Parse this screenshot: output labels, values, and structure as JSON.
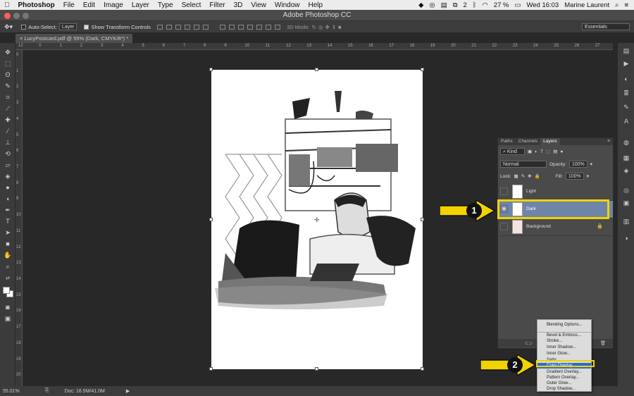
{
  "menubar": {
    "apple": "",
    "items": [
      "Photoshop",
      "File",
      "Edit",
      "Image",
      "Layer",
      "Type",
      "Select",
      "Filter",
      "3D",
      "View",
      "Window",
      "Help"
    ],
    "battery": "27 %",
    "clock": "Wed 16:03",
    "user": "Marine Laurent",
    "badge_num": "2"
  },
  "window": {
    "title": "Adobe Photoshop CC"
  },
  "options": {
    "auto_select_label": "Auto-Select:",
    "auto_select_value": "Layer",
    "show_transform_label": "Show Transform Controls",
    "mode_label": "3D Mode:",
    "workspace": "Essentials"
  },
  "document": {
    "tab": "LucyPostcard.pdf @ 55% (Dark, CMYK/8*) *",
    "ruler_numbers": [
      "12",
      "0",
      "1",
      "2",
      "3",
      "4",
      "5",
      "6",
      "7",
      "8",
      "9",
      "10",
      "11",
      "12",
      "13",
      "14",
      "15",
      "16",
      "17",
      "18",
      "19",
      "20",
      "21",
      "22",
      "23",
      "24",
      "25",
      "26",
      "27"
    ],
    "vruler_numbers": [
      "0",
      "1",
      "2",
      "3",
      "4",
      "5",
      "6",
      "7",
      "8",
      "9",
      "10",
      "11",
      "12",
      "13",
      "14",
      "15",
      "16",
      "17",
      "18",
      "19",
      "20"
    ]
  },
  "status": {
    "zoom": "55.01%",
    "doc": "Doc: 16.5M/41.0M"
  },
  "layers_panel": {
    "tabs": [
      "Paths",
      "Channels",
      "Layers"
    ],
    "active_tab": "Layers",
    "kind_label": "Kind",
    "blend_mode": "Normal",
    "opacity_label": "Opacity:",
    "opacity_value": "100%",
    "lock_label": "Lock:",
    "fill_label": "Fill:",
    "fill_value": "100%",
    "layers": [
      {
        "name": "Light",
        "visible": false
      },
      {
        "name": "Dark",
        "visible": true,
        "selected": true
      },
      {
        "name": "Background",
        "visible": false,
        "locked": true
      }
    ]
  },
  "context_menu": {
    "items": [
      {
        "label": "Blending Options..."
      },
      {
        "label": "Bevel & Emboss..."
      },
      {
        "label": "Stroke..."
      },
      {
        "label": "Inner Shadow..."
      },
      {
        "label": "Inner Glow..."
      },
      {
        "label": "Satin..."
      },
      {
        "label": "Color Overlay...",
        "highlighted": true
      },
      {
        "label": "Gradient Overlay..."
      },
      {
        "label": "Pattern Overlay..."
      },
      {
        "label": "Outer Glow..."
      },
      {
        "label": "Drop Shadow..."
      }
    ]
  },
  "callouts": [
    {
      "number": "1"
    },
    {
      "number": "2"
    }
  ],
  "colors": {
    "callout_yellow": "#f2d200",
    "selected_layer": "#6f85a8",
    "menu_highlight": "#2e6cc5"
  }
}
